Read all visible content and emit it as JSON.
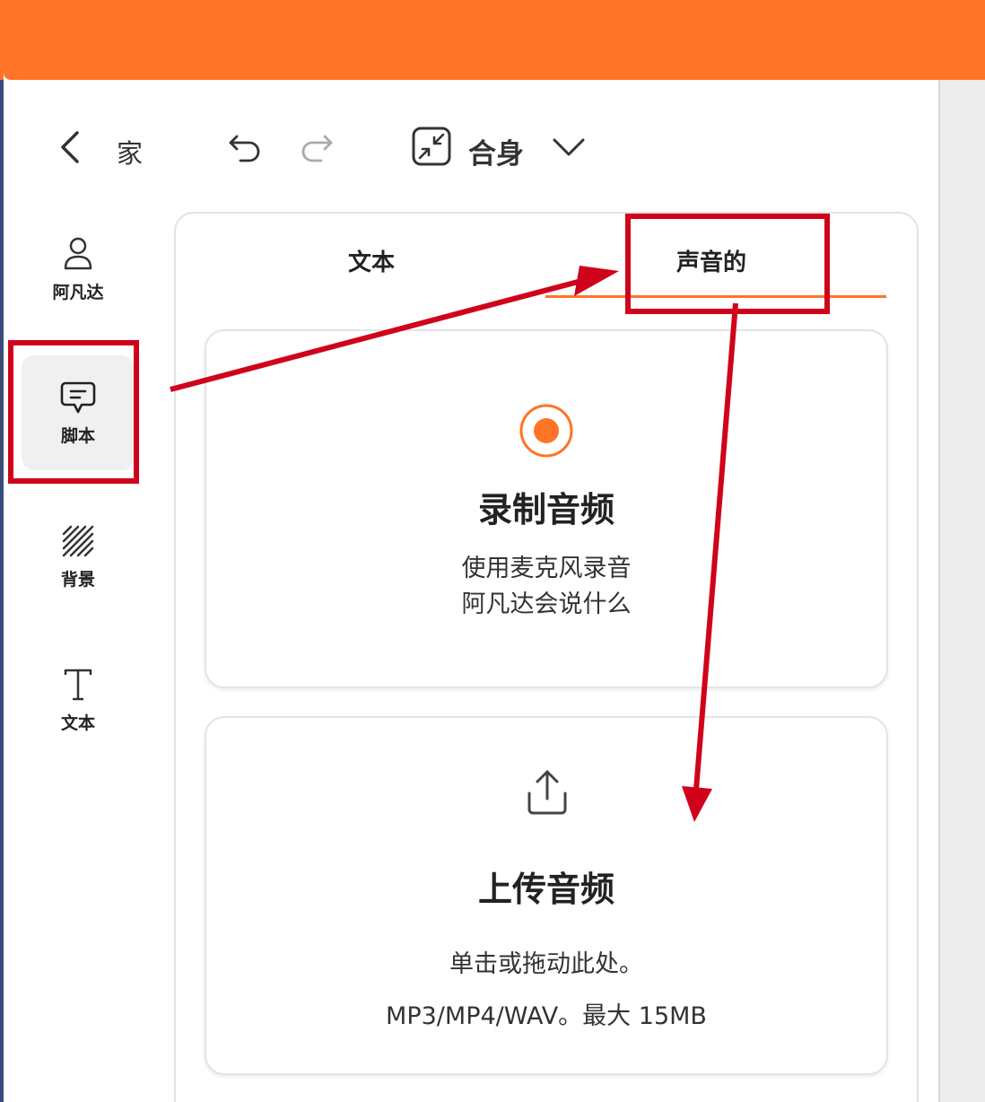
{
  "toolbar": {
    "home_label": "家",
    "fit_label": "合身"
  },
  "sidebar": {
    "items": [
      {
        "label": "阿凡达",
        "icon": "person-icon"
      },
      {
        "label": "脚本",
        "icon": "chat-icon",
        "active": true
      },
      {
        "label": "背景",
        "icon": "hatch-pattern-icon"
      },
      {
        "label": "文本",
        "icon": "text-t-icon"
      }
    ]
  },
  "tabs": [
    {
      "label": "文本"
    },
    {
      "label": "声音的",
      "active": true
    }
  ],
  "record_card": {
    "title": "录制音频",
    "line1": "使用麦克风录音",
    "line2": "阿凡达会说什么"
  },
  "upload_card": {
    "title": "上传音频",
    "line1": "单击或拖动此处。",
    "line2": "MP3/MP4/WAV。最大 15MB"
  },
  "colors": {
    "accent": "#ff7426",
    "annotation": "#d0021b"
  }
}
